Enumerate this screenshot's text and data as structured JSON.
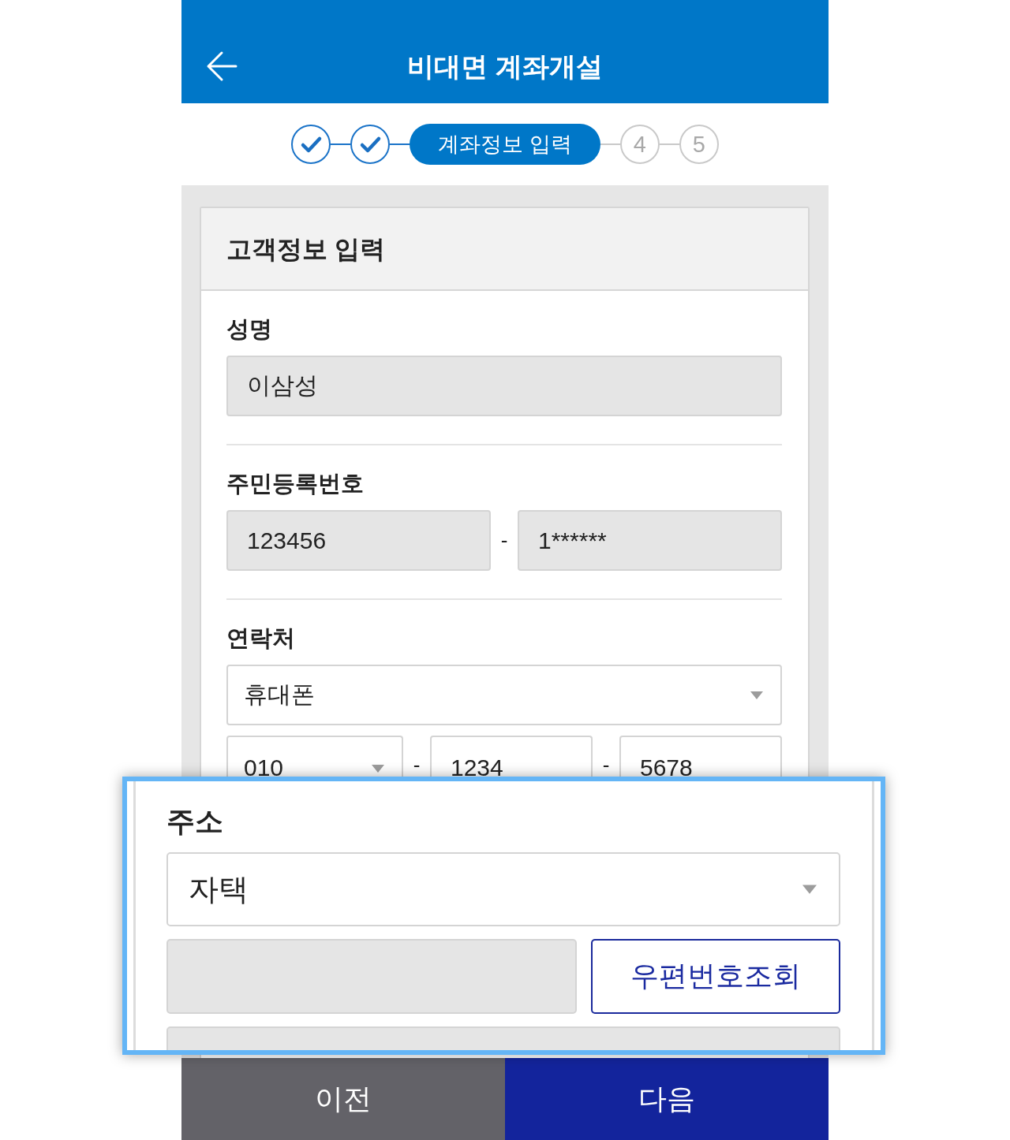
{
  "header": {
    "title": "비대면 계좌개설"
  },
  "steps": [
    {
      "kind": "done"
    },
    {
      "kind": "done"
    },
    {
      "kind": "current",
      "label": "계좌정보 입력"
    },
    {
      "kind": "upcoming",
      "label": "4"
    },
    {
      "kind": "upcoming",
      "label": "5"
    }
  ],
  "card": {
    "title": "고객정보 입력",
    "sections": [
      {
        "label": "성명",
        "rows": [
          [
            {
              "kind": "field",
              "value": "이삼성",
              "disabled": true
            }
          ]
        ]
      },
      {
        "label": "주민등록번호",
        "rows": [
          [
            {
              "kind": "field",
              "value": "123456",
              "disabled": true
            },
            {
              "kind": "separator",
              "text": "-"
            },
            {
              "kind": "field",
              "value": "1******",
              "disabled": true
            }
          ]
        ]
      },
      {
        "label": "연락처",
        "rows": [
          [
            {
              "kind": "select",
              "value": "휴대폰"
            }
          ],
          [
            {
              "kind": "select",
              "value": "010"
            },
            {
              "kind": "separator",
              "text": "-"
            },
            {
              "kind": "field",
              "value": "1234",
              "disabled": false
            },
            {
              "kind": "separator",
              "text": "-"
            },
            {
              "kind": "field",
              "value": "5678",
              "disabled": false
            }
          ]
        ]
      }
    ]
  },
  "callout": {
    "label": "주소",
    "rows": [
      [
        {
          "kind": "select",
          "value": "자택"
        }
      ],
      [
        {
          "kind": "field",
          "disabled": true
        },
        {
          "kind": "button",
          "label": "우편번호조회"
        }
      ],
      [
        {
          "kind": "field",
          "disabled": true
        }
      ]
    ]
  },
  "footer": {
    "buttons": [
      {
        "kind": "secondary",
        "label": "이전"
      },
      {
        "kind": "primary",
        "label": "다음"
      }
    ]
  }
}
